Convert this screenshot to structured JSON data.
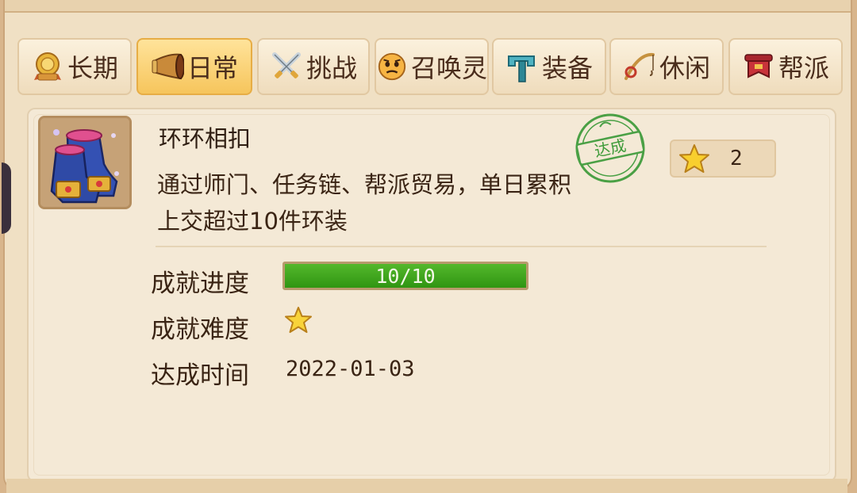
{
  "tabs": [
    {
      "label": "长期",
      "icon": "medal-icon",
      "active": false
    },
    {
      "label": "日常",
      "icon": "horn-icon",
      "active": true
    },
    {
      "label": "挑战",
      "icon": "crossed-swords-icon",
      "active": false
    },
    {
      "label": "召唤灵",
      "icon": "face-icon",
      "active": false
    },
    {
      "label": "装备",
      "icon": "hammer-icon",
      "active": false
    },
    {
      "label": "休闲",
      "icon": "fishing-rod-icon",
      "active": false
    },
    {
      "label": "帮派",
      "icon": "banner-icon",
      "active": false
    }
  ],
  "achievement": {
    "title": "环环相扣",
    "description": "通过师门、任务链、帮派贸易，单日累积上交超过10件环装",
    "stamp_text": "达成",
    "reward_count": "2",
    "progress_label": "成就进度",
    "progress_text": "10/10",
    "progress_value": 1.0,
    "difficulty_label": "成就难度",
    "difficulty_stars": 1,
    "time_label": "达成时间",
    "time_value": "2022-01-03",
    "item_icon": "boots-icon"
  },
  "colors": {
    "accent_active_tab": "#f6c55c",
    "progress_fill": "#3aa51a",
    "stamp_green": "#3f9b3a"
  }
}
